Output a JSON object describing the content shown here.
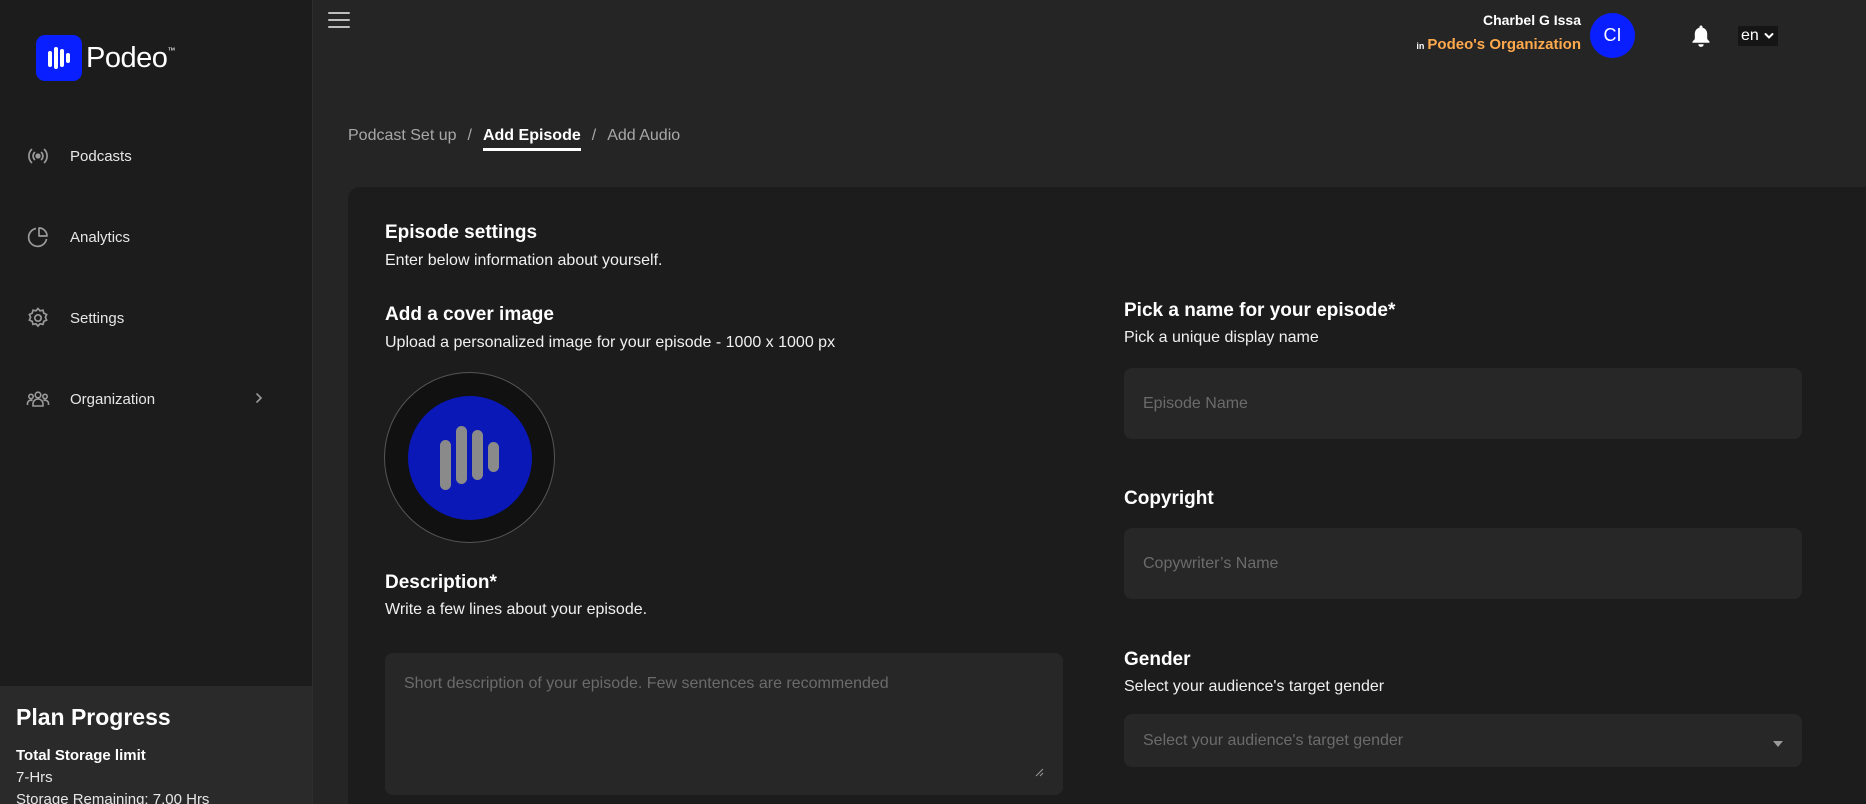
{
  "brand": {
    "name": "Podeo",
    "tm": "™"
  },
  "sidebar": {
    "items": [
      {
        "label": "Podcasts",
        "icon": "broadcast-icon"
      },
      {
        "label": "Analytics",
        "icon": "pie-chart-icon"
      },
      {
        "label": "Settings",
        "icon": "gear-icon"
      },
      {
        "label": "Organization",
        "icon": "users-icon"
      }
    ]
  },
  "plan": {
    "title": "Plan Progress",
    "storage_label": "Total Storage limit",
    "storage_value": "7-Hrs",
    "remaining": "Storage Remaining: 7.00 Hrs"
  },
  "user": {
    "name": "Charbel G Issa",
    "in": "in",
    "org": "Podeo's Organization",
    "initials": "CI"
  },
  "lang": "en",
  "breadcrumb": [
    "Podcast Set up",
    "Add Episode",
    "Add Audio"
  ],
  "form": {
    "title": "Episode settings",
    "subtitle": "Enter below information about yourself.",
    "cover_title": "Add a cover image",
    "cover_sub": "Upload a personalized image for your episode - 1000 x 1000 px",
    "desc_title": "Description*",
    "desc_sub": "Write a few lines about your episode.",
    "desc_placeholder": "Short description of your episode. Few sentences are recommended",
    "name_title": "Pick a name for your episode*",
    "name_sub": "Pick a unique display name",
    "name_placeholder": "Episode Name",
    "copyright_title": "Copyright",
    "copyright_placeholder": "Copywriter’s Name",
    "gender_title": "Gender",
    "gender_sub": "Select your audience's target gender",
    "gender_placeholder": "Select your audience's target gender"
  },
  "colors": {
    "accent": "#0a1fff",
    "org": "#ffa94d"
  }
}
